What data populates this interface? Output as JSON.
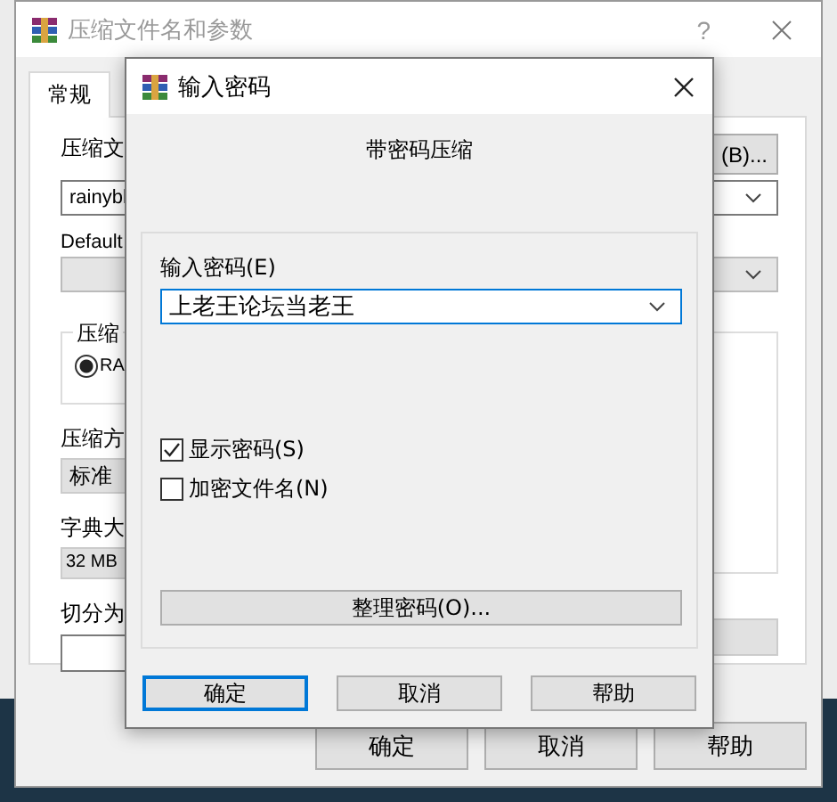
{
  "back_window": {
    "title": "压缩文件名和参数",
    "help": "?",
    "tabs": [
      {
        "label": "常规",
        "selected": true
      }
    ],
    "browse_button": "(B)...",
    "archive_label": "压缩文",
    "archive_name": "rainybl",
    "profile_label": "Default",
    "format_group": {
      "caption": "压缩",
      "options": [
        {
          "label": "RA",
          "selected": true
        }
      ]
    },
    "method_label": "压缩方",
    "method": "标准",
    "dict_label": "字典大",
    "dict": "32 MB",
    "split_label": "切分为",
    "buttons": [
      "确定",
      "取消",
      "帮助"
    ]
  },
  "dialog": {
    "title": "输入密码",
    "heading": "带密码压缩",
    "password_label": "输入密码(E)",
    "password": "上老王论坛当老王",
    "options": [
      {
        "label": "显示密码(S)",
        "checked": true
      },
      {
        "label": "加密文件名(N)",
        "checked": false
      }
    ],
    "organize_button": "整理密码(O)...",
    "buttons": [
      {
        "label": "确定",
        "default": true
      },
      {
        "label": "取消",
        "default": false
      },
      {
        "label": "帮助",
        "default": false
      }
    ]
  }
}
